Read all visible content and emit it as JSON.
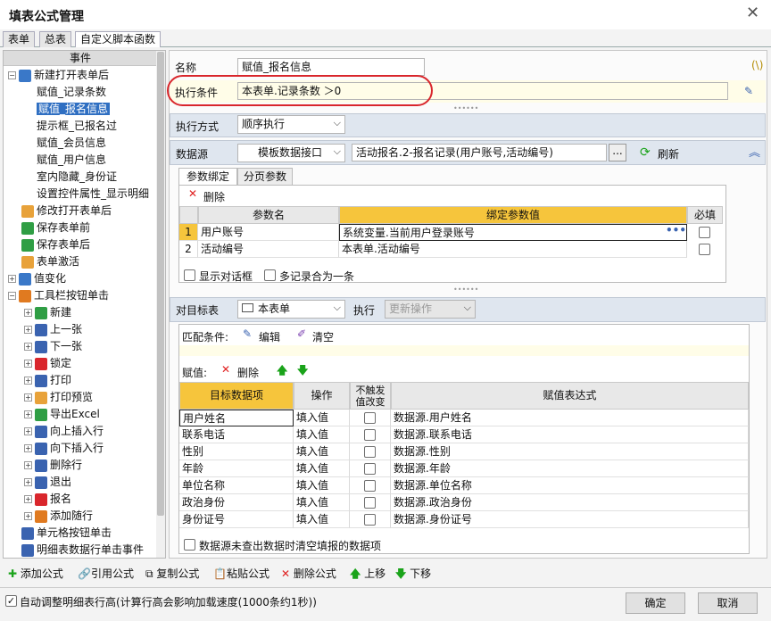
{
  "window": {
    "title": "填表公式管理"
  },
  "tabs": [
    "表单",
    "总表",
    "自定义脚本函数"
  ],
  "left_panel": {
    "header": "事件",
    "tree": [
      {
        "label": "新建打开表单后",
        "level": 0,
        "expander": "minus",
        "icon": "user-add-icon"
      },
      {
        "label": "赋值_记录条数",
        "level": 1
      },
      {
        "label": "赋值_报名信息",
        "level": 1,
        "selected": true
      },
      {
        "label": "提示框_已报名过",
        "level": 1
      },
      {
        "label": "赋值_会员信息",
        "level": 1
      },
      {
        "label": "赋值_用户信息",
        "level": 1
      },
      {
        "label": "室内隐藏_身份证",
        "level": 1
      },
      {
        "label": "设置控件属性_显示明细",
        "level": 1
      },
      {
        "label": "修改打开表单后",
        "level": 0,
        "icon": "folder-open-icon"
      },
      {
        "label": "保存表单前",
        "level": 0,
        "icon": "save-green-icon"
      },
      {
        "label": "保存表单后",
        "level": 0,
        "icon": "save-green-icon"
      },
      {
        "label": "表单激活",
        "level": 0,
        "icon": "folder-icon"
      },
      {
        "label": "值变化",
        "level": 0,
        "expander": "plus",
        "icon": "123-icon"
      },
      {
        "label": "工具栏按钮单击",
        "level": 0,
        "expander": "minus",
        "icon": "tools-icon"
      },
      {
        "label": "新建",
        "level": 1,
        "expander": "plus",
        "icon": "new-icon"
      },
      {
        "label": "上一张",
        "level": 1,
        "expander": "plus",
        "icon": "prev-icon"
      },
      {
        "label": "下一张",
        "level": 1,
        "expander": "plus",
        "icon": "next-icon"
      },
      {
        "label": "锁定",
        "level": 1,
        "expander": "plus",
        "icon": "lock-icon"
      },
      {
        "label": "打印",
        "level": 1,
        "expander": "plus",
        "icon": "print-icon"
      },
      {
        "label": "打印预览",
        "level": 1,
        "expander": "plus",
        "icon": "print-preview-icon"
      },
      {
        "label": "导出Excel",
        "level": 1,
        "expander": "plus",
        "icon": "excel-icon"
      },
      {
        "label": "向上插入行",
        "level": 1,
        "expander": "plus",
        "icon": "insert-up-icon"
      },
      {
        "label": "向下插入行",
        "level": 1,
        "expander": "plus",
        "icon": "insert-down-icon"
      },
      {
        "label": "删除行",
        "level": 1,
        "expander": "plus",
        "icon": "delete-row-icon"
      },
      {
        "label": "退出",
        "level": 1,
        "expander": "plus",
        "icon": "power-icon"
      },
      {
        "label": "报名",
        "level": 1,
        "expander": "plus",
        "icon": "rocket-icon"
      },
      {
        "label": "添加随行",
        "level": 1,
        "expander": "plus",
        "icon": "tools-icon"
      },
      {
        "label": "单元格按钮单击",
        "level": 0,
        "icon": "dots-icon"
      },
      {
        "label": "明细表数据行单击事件",
        "level": 0,
        "icon": "gear-icon"
      }
    ]
  },
  "form": {
    "name_label": "名称",
    "name_value": "赋值_报名信息",
    "cond_label": "执行条件",
    "cond_value": "本表单.记录条数 ＞0",
    "hint_icon": "(\\)",
    "mode_label": "执行方式",
    "mode_value": "顺序执行",
    "datasource_label": "数据源",
    "datasource_type": "模板数据接口",
    "datasource_value": "活动报名.2-报名记录(用户账号,活动编号)",
    "browse_label": "...",
    "refresh_label": "刷新"
  },
  "param": {
    "tabs": [
      "参数绑定",
      "分页参数"
    ],
    "delete_label": "删除",
    "headers": [
      "参数名",
      "绑定参数值",
      "必填"
    ],
    "rows": [
      {
        "num": "1",
        "name": "用户账号",
        "value": "系统变量.当前用户登录账号"
      },
      {
        "num": "2",
        "name": "活动编号",
        "value": "本表单.活动编号"
      }
    ],
    "dialog_label": "显示对话框",
    "merge_label": "多记录合为一条"
  },
  "target": {
    "label": "对目标表",
    "table_value": "本表单",
    "exec_label": "执行",
    "exec_value": "更新操作",
    "match_label": "匹配条件:",
    "edit_label": "编辑",
    "clear_label": "清空",
    "assign_label": "赋值:",
    "delete_label": "删除",
    "headers": [
      "目标数据项",
      "操作",
      "不触发值改变",
      "赋值表达式"
    ],
    "rows": [
      {
        "field": "用户姓名",
        "op": "填入值",
        "expr": "数据源.用户姓名"
      },
      {
        "field": "联系电话",
        "op": "填入值",
        "expr": "数据源.联系电话"
      },
      {
        "field": "性别",
        "op": "填入值",
        "expr": "数据源.性别"
      },
      {
        "field": "年龄",
        "op": "填入值",
        "expr": "数据源.年龄"
      },
      {
        "field": "单位名称",
        "op": "填入值",
        "expr": "数据源.单位名称"
      },
      {
        "field": "政治身份",
        "op": "填入值",
        "expr": "数据源.政治身份"
      },
      {
        "field": "身份证号",
        "op": "填入值",
        "expr": "数据源.身份证号"
      }
    ],
    "clear_unfound_label": "数据源未查出数据时清空填报的数据项"
  },
  "toolbar": {
    "add": "添加公式",
    "ref": "引用公式",
    "copy": "复制公式",
    "paste": "粘贴公式",
    "delete": "删除公式",
    "up": "上移",
    "down": "下移"
  },
  "footer": {
    "auto_label": "自动调整明细表行高(计算行高会影响加载速度(1000条约1秒))",
    "ok": "确定",
    "cancel": "取消"
  },
  "colors": {
    "accent_yellow": "#f6c53c",
    "selection_blue": "#2f6fc2",
    "highlight_red": "#d9262c"
  }
}
